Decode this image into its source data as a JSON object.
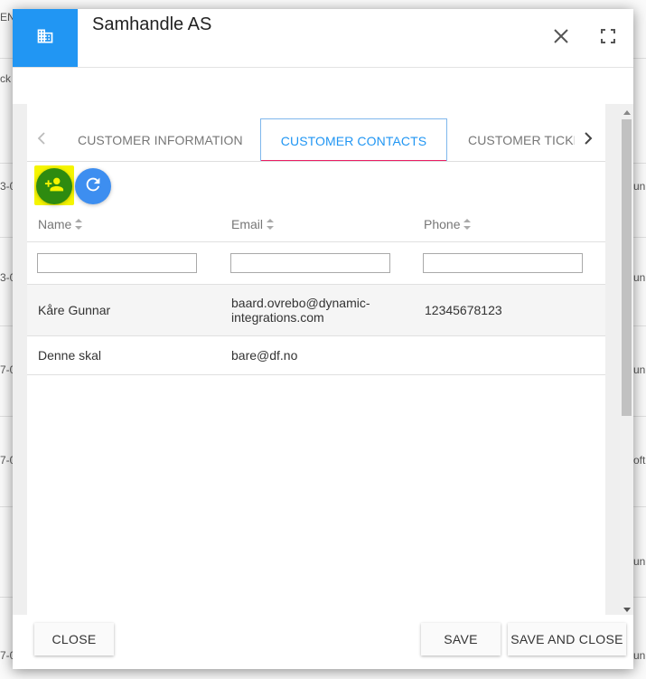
{
  "background": {
    "fragments": [
      "EN",
      "ck",
      "3-0",
      "un",
      "3-0",
      "un",
      "7-0",
      "un",
      "7-0",
      "oft",
      "un",
      "7-0",
      "un"
    ]
  },
  "dialog": {
    "title": "Samhandle AS",
    "header_icon": "office-building-icon",
    "accent_color": "#2196f3"
  },
  "tabs": [
    {
      "label": "CUSTOMER INFORMATION",
      "active": false
    },
    {
      "label": "CUSTOMER CONTACTS",
      "active": true
    },
    {
      "label": "CUSTOMER TICKETS",
      "active": false
    }
  ],
  "actions": {
    "add_icon": "add-contact-icon",
    "refresh_icon": "refresh-icon"
  },
  "table": {
    "columns": [
      "Name",
      "Email",
      "Phone"
    ],
    "filters": {
      "name": "",
      "email": "",
      "phone": ""
    },
    "rows": [
      {
        "name": "Kåre Gunnar",
        "email": "baard.ovrebo@dynamic-integrations.com",
        "phone": "12345678123"
      },
      {
        "name": "Denne skal",
        "email": "bare@df.no",
        "phone": ""
      }
    ]
  },
  "footer": {
    "close_label": "CLOSE",
    "save_label": "SAVE",
    "save_close_label": "SAVE AND CLOSE"
  }
}
